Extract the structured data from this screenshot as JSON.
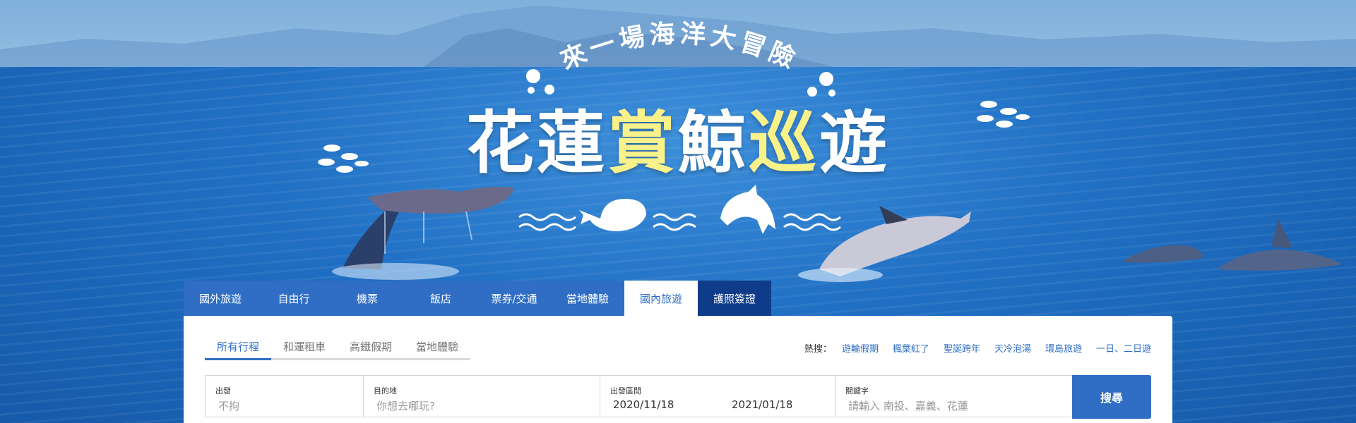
{
  "hero": {
    "tagline": "來一場海洋大冒險",
    "title_white": "花蓮",
    "title_yellow1": "賞",
    "title_white2": "鯨",
    "title_yellow2": "巡",
    "title_white3": "遊"
  },
  "tabs": [
    {
      "label": "國外旅遊"
    },
    {
      "label": "自由行"
    },
    {
      "label": "機票"
    },
    {
      "label": "飯店"
    },
    {
      "label": "票券/交通"
    },
    {
      "label": "當地體驗"
    },
    {
      "label": "國內旅遊",
      "active": true
    },
    {
      "label": "護照簽證"
    }
  ],
  "subtabs": [
    {
      "label": "所有行程",
      "active": true
    },
    {
      "label": "和運租車"
    },
    {
      "label": "高鐵假期"
    },
    {
      "label": "當地體驗"
    }
  ],
  "hot_search": {
    "label": "熱搜：",
    "links": [
      "遊輪假期",
      "楓葉紅了",
      "聖誕跨年",
      "天冷泡湯",
      "環島旅遊",
      "一日、二日遊"
    ]
  },
  "form": {
    "depart_label": "出發",
    "depart_value": "不拘",
    "dest_label": "目的地",
    "dest_placeholder": "你想去哪玩?",
    "dates_label": "出發區間",
    "date_start": "2020/11/18",
    "date_end": "2021/01/18",
    "keyword_label": "關鍵字",
    "keyword_placeholder": "請輸入 南投、嘉義、花蓮",
    "search_label": "搜尋"
  },
  "colors": {
    "primary": "#2f6ec4",
    "visa_tab": "#0f3c8a",
    "title_yellow": "#f9f28a"
  }
}
